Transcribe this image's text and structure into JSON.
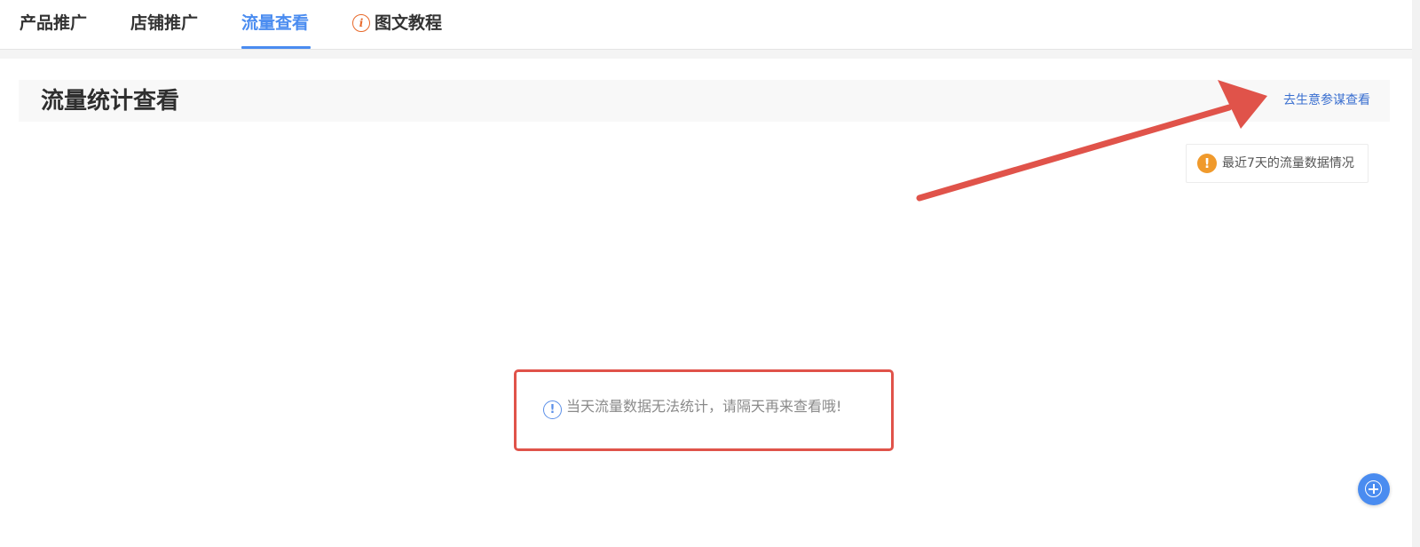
{
  "tabs": [
    {
      "label": "产品推广",
      "active": false
    },
    {
      "label": "店铺推广",
      "active": false
    },
    {
      "label": "流量查看",
      "active": true
    },
    {
      "label": "图文教程",
      "active": false,
      "icon": "info-icon"
    }
  ],
  "header": {
    "title": "流量统计查看",
    "link_label": "去生意参谋查看"
  },
  "legend": {
    "icon": "warning-icon",
    "text": "最近7天的流量数据情况"
  },
  "empty_state": {
    "icon": "info-icon",
    "message": "当天流量数据无法统计，请隔天再来查看哦!"
  },
  "fab": {
    "icon": "plus-circle-icon"
  },
  "colors": {
    "accent": "#4a8cf0",
    "link": "#3a6fd0",
    "warning": "#f09a2c",
    "annotation": "#e0534a",
    "tab_info_icon": "#e8692a"
  }
}
